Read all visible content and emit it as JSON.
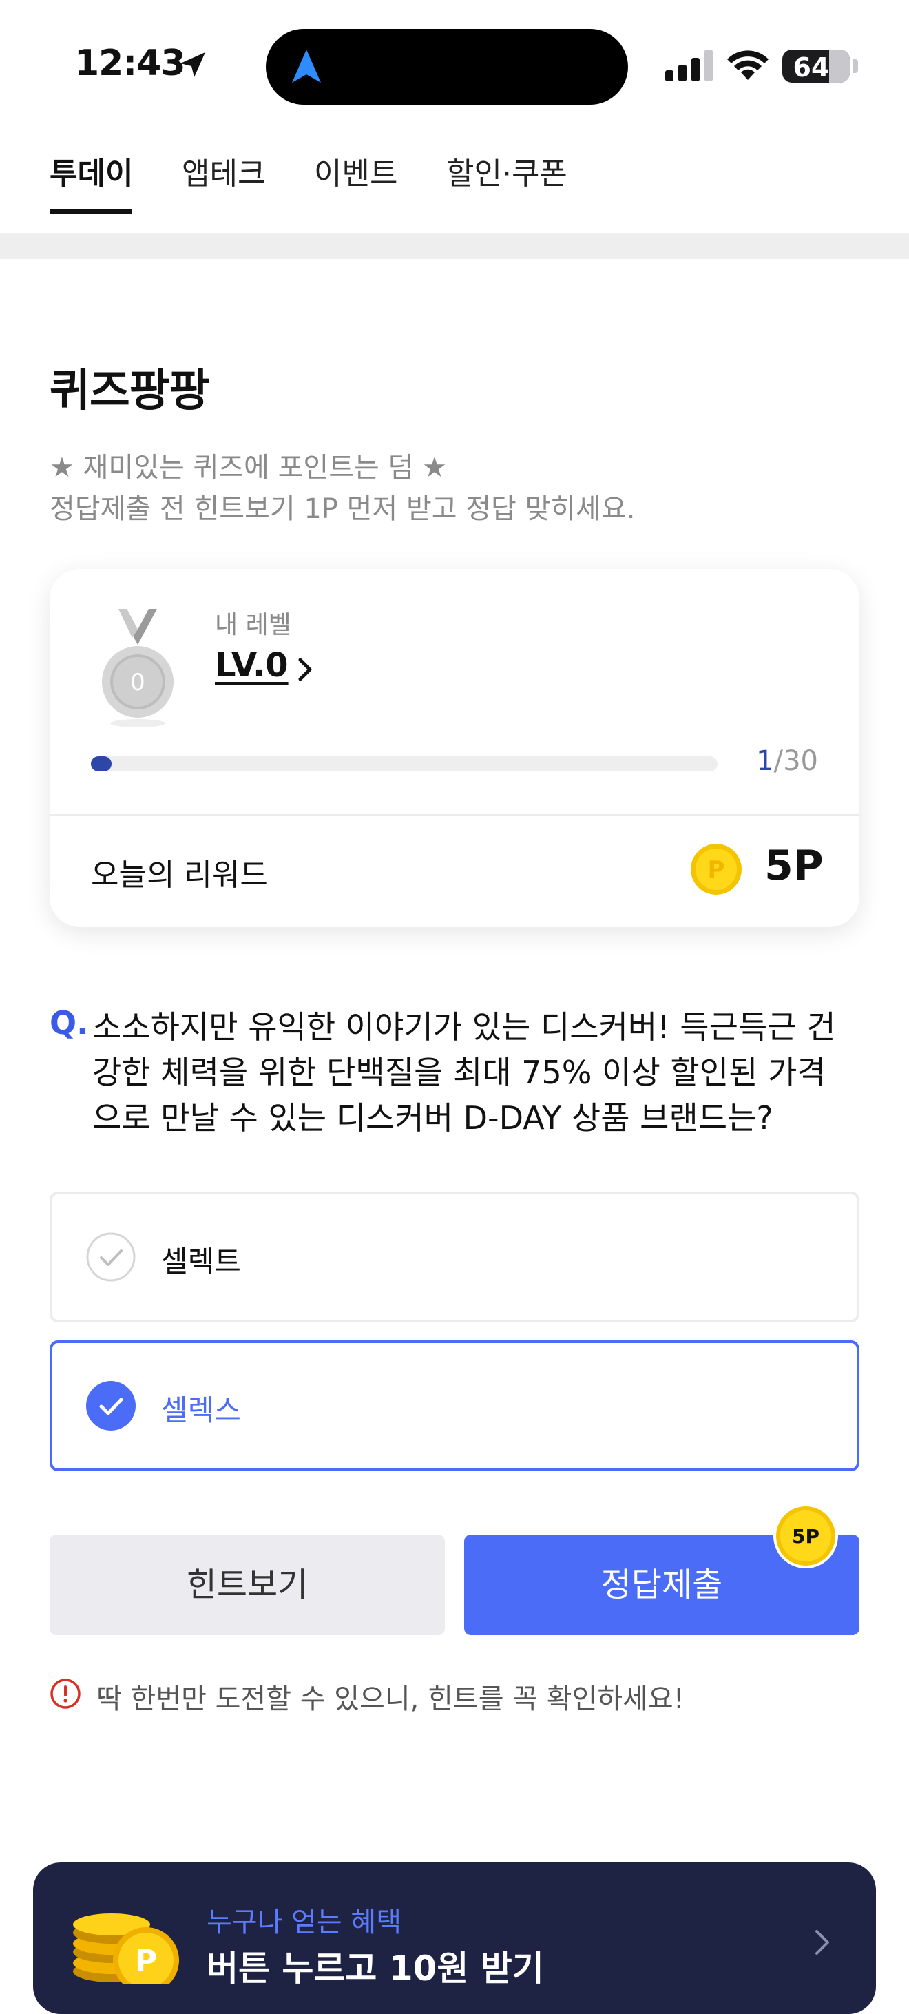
{
  "status_bar": {
    "time": "12:43",
    "battery": "64"
  },
  "tabs": [
    {
      "label": "투데이",
      "active": true
    },
    {
      "label": "앱테크",
      "active": false
    },
    {
      "label": "이벤트",
      "active": false
    },
    {
      "label": "할인·쿠폰",
      "active": false
    }
  ],
  "quiz": {
    "title": "퀴즈팡팡",
    "subtitle_line1": "★ 재미있는 퀴즈에 포인트는 덤 ★",
    "subtitle_line2": "정답제출 전 힌트보기 1P 먼저 받고 정답 맞히세요."
  },
  "level_card": {
    "medal_number": "0",
    "label": "내 레벨",
    "level": "LV.0",
    "progress_current": "1",
    "progress_sep_total": "/30",
    "progress_fraction": 0.033,
    "reward_label": "오늘의 리워드",
    "reward_value": "5P"
  },
  "question": {
    "q_mark": "Q.",
    "line1": "소소하지만 유익한 이야기가 있는 디스커버! 득근득근 건",
    "line2": "강한 체력을 위한 단백질을 최대 75% 이상 할인된 가격",
    "line3": "으로 만날 수 있는 디스커버 D-DAY 상품 브랜드는?"
  },
  "options": [
    {
      "label": "셀렉트",
      "selected": false
    },
    {
      "label": "셀렉스",
      "selected": true
    }
  ],
  "buttons": {
    "hint": "힌트보기",
    "submit": "정답제출",
    "submit_badge": "5P"
  },
  "warning": "딱 한번만 도전할 수 있으니, 힌트를 꼭 확인하세요!",
  "banner": {
    "subtitle": "누구나 얻는 혜택",
    "title": "버튼 누르고 10원 받기"
  },
  "colors": {
    "accent": "#4a6cf7",
    "progress": "#2e46a8",
    "banner_bg": "#1e2243",
    "coin": "#f8d000"
  }
}
